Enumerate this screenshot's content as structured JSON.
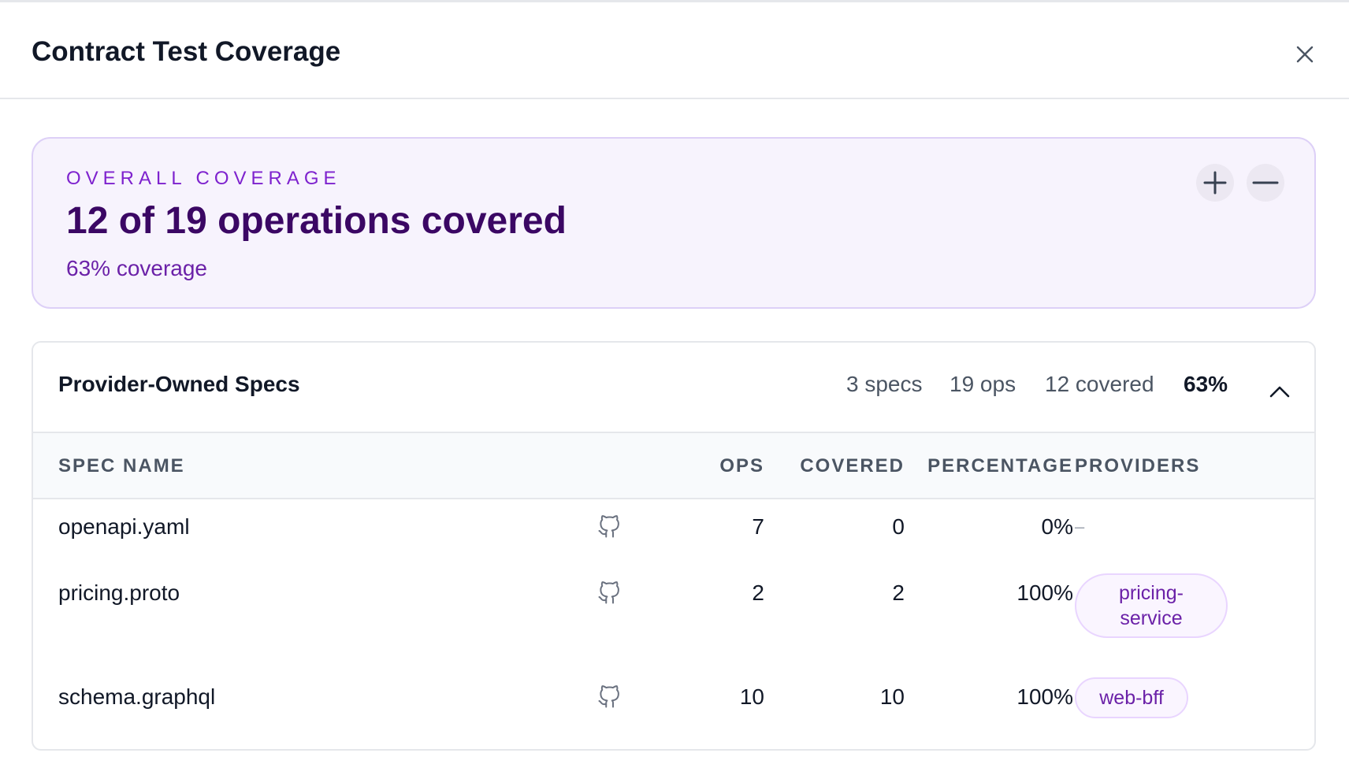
{
  "dialog": {
    "title": "Contract Test Coverage",
    "close_label": "close"
  },
  "summary": {
    "label": "OVERALL COVERAGE",
    "headline": "12 of 19 operations covered",
    "subline": "63% coverage",
    "covered": 12,
    "total": 19,
    "percent": 63
  },
  "section": {
    "title": "Provider-Owned Specs",
    "stats": {
      "specs": "3 specs",
      "ops": "19 ops",
      "covered": "12 covered",
      "percentage": "63%"
    },
    "columns": {
      "spec_name": "SPEC NAME",
      "ops": "OPS",
      "covered": "COVERED",
      "percentage": "PERCENTAGE",
      "providers": "PROVIDERS"
    },
    "rows": [
      {
        "name": "openapi.yaml",
        "ops": "7",
        "covered": "0",
        "percentage": "0%",
        "providers": "–"
      },
      {
        "name": "pricing.proto",
        "ops": "2",
        "covered": "2",
        "percentage": "100%",
        "providers": "pricing-service",
        "provider_line1": "pricing-",
        "provider_line2": "service"
      },
      {
        "name": "schema.graphql",
        "ops": "10",
        "covered": "10",
        "percentage": "100%",
        "providers": "web-bff"
      }
    ]
  },
  "icons": {
    "close": "close-icon",
    "zoom_in": "plus-icon",
    "zoom_out": "minus-icon",
    "collapse": "chevron-up-icon",
    "repo": "github-icon"
  },
  "colors": {
    "accent": "#7e22ce",
    "accent_dark": "#3b0764",
    "summary_bg": "#f7f3fd",
    "pill_bg": "#faf5ff",
    "pill_border": "#e9d5ff"
  }
}
